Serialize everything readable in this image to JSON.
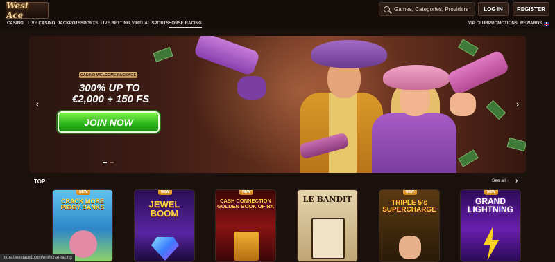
{
  "header": {
    "logo_text": "West Ace",
    "search_placeholder": "Games, Categories, Providers",
    "login_label": "LOG IN",
    "register_label": "REGISTER"
  },
  "nav": {
    "left": [
      "CASINO",
      "LIVE CASINO",
      "JACKPOTS",
      "SPORTS",
      "LIVE BETTING",
      "VIRTUAL SPORTS",
      "HORSE RACING"
    ],
    "right": [
      "VIP CLUB",
      "PROMOTIONS",
      "REWARDS"
    ],
    "active": "HORSE RACING"
  },
  "banner": {
    "badge": "CASINO WELCOME PACKAGE",
    "line1": "300% UP TO",
    "line2": "€2,000 + 150 FS",
    "cta": "JOIN NOW",
    "prev_arrow": "‹",
    "next_arrow": "›"
  },
  "top_section": {
    "title": "TOP",
    "see_all": "See all",
    "prev": "‹",
    "next": "›",
    "games": [
      {
        "badge": "NEW",
        "title": "CRACK MORE PIGGY BANKS",
        "bg": "#3aa0d8"
      },
      {
        "badge": "NEW",
        "title": "JEWEL BOOM",
        "bg": "#3b1a6e"
      },
      {
        "badge": "NEW",
        "title": "CASH CONNECTION GOLDEN BOOK OF RA",
        "bg": "#6b0f0f"
      },
      {
        "badge": "",
        "title": "LE BANDIT",
        "bg": "#d7c39a"
      },
      {
        "badge": "NEW",
        "title": "TRIPLE 5's SUPERCHARGE",
        "bg": "#3b2a12"
      },
      {
        "badge": "NEW",
        "title": "GRAND LIGHTNING",
        "bg": "#3a0c6a"
      }
    ]
  },
  "status_url": "https://westace1.com/en/horse-racing",
  "colors": {
    "background": "#120c09",
    "cta_green": "#2bb71a",
    "badge_orange": "#d27f15"
  }
}
